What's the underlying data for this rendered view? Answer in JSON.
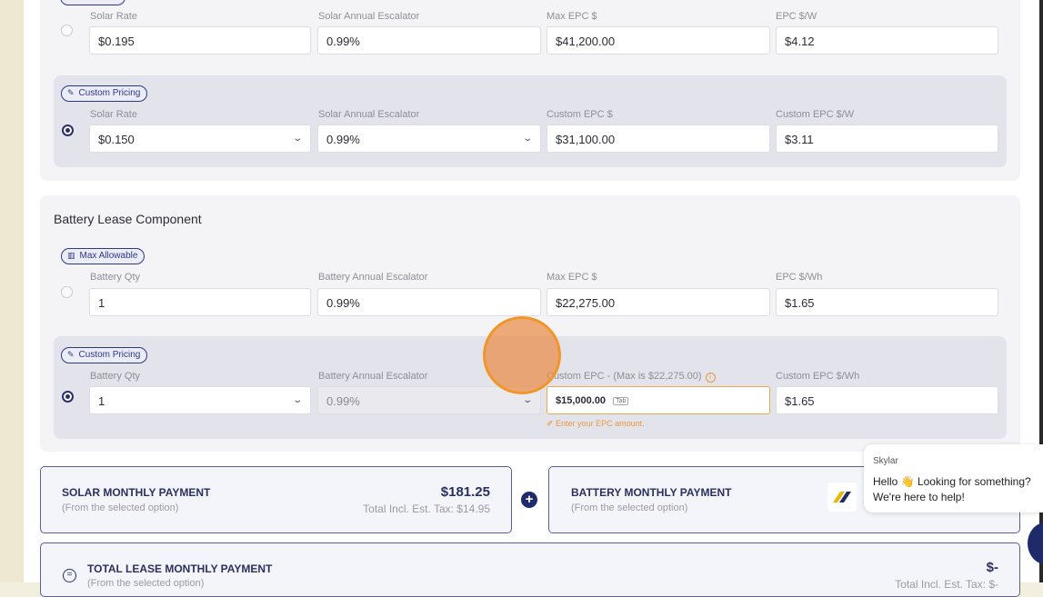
{
  "solar_section": {
    "max_option": {
      "labels": [
        "Solar Rate",
        "Solar Annual Escalator",
        "Max EPC $",
        "EPC $/W"
      ],
      "values": [
        "$0.195",
        "0.99%",
        "$41,200.00",
        "$4.12"
      ]
    },
    "custom_option": {
      "badge": "Custom Pricing",
      "labels": [
        "Solar Rate",
        "Solar Annual Escalator",
        "Custom EPC $",
        "Custom EPC $/W"
      ],
      "values": [
        "$0.150",
        "0.99%",
        "$31,100.00",
        "$3.11"
      ]
    }
  },
  "battery_section": {
    "title": "Battery Lease Component",
    "max_option": {
      "badge": "Max Allowable",
      "labels": [
        "Battery Qty",
        "Battery Annual Escalator",
        "Max EPC $",
        "EPC $/Wh"
      ],
      "values": [
        "1",
        "0.99%",
        "$22,275.00",
        "$1.65"
      ]
    },
    "custom_option": {
      "badge": "Custom Pricing",
      "labels": [
        "Battery Qty",
        "Battery Annual Escalator",
        "Custom EPC - (Max is $22,275.00)",
        "Custom EPC $/Wh"
      ],
      "values": [
        "1",
        "0.99%",
        "$15,000.00",
        "$1.65"
      ],
      "tab_hint": "Tab",
      "helper": "Enter your EPC amount."
    }
  },
  "payments": {
    "solar": {
      "title": "SOLAR MONTHLY PAYMENT",
      "subtitle": "(From the selected option)",
      "amount": "$181.25",
      "tax": "Total Incl. Est. Tax: $14.95"
    },
    "battery": {
      "title": "BATTERY MONTHLY PAYMENT",
      "subtitle": "(From the selected option)"
    },
    "total": {
      "title": "TOTAL LEASE MONTHLY PAYMENT",
      "subtitle": "(From the selected option)",
      "amount": "$-",
      "tax": "Total Incl. Est. Tax: $-"
    }
  },
  "chat": {
    "name": "Skylar",
    "message": "Hello 👋 Looking for something? We're here to help!"
  }
}
